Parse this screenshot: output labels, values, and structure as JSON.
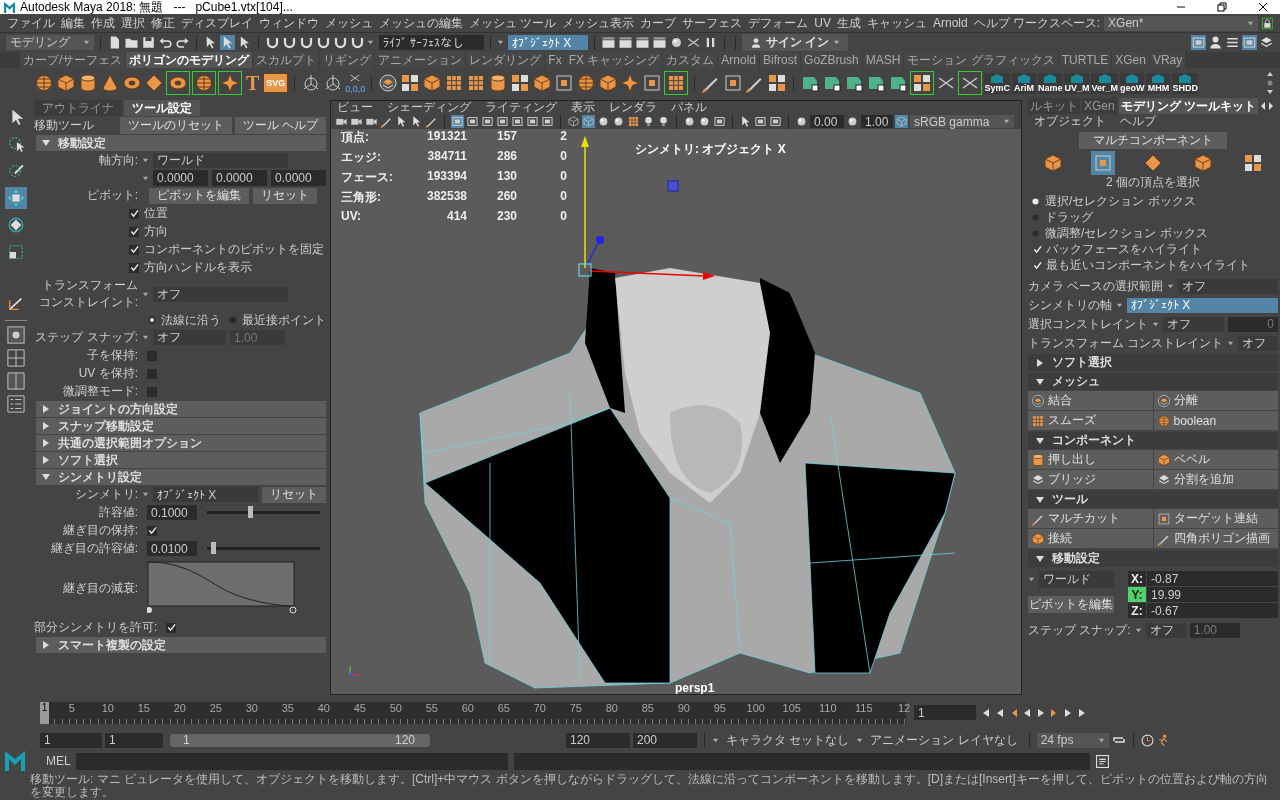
{
  "title_bar": {
    "title": "Autodesk Maya 2018: 無題   ---   pCube1.vtx[104]..."
  },
  "menu_bar": {
    "items": [
      "ファイル",
      "編集",
      "作成",
      "選択",
      "修正",
      "ディスプレイ",
      "ウィンドウ",
      "メッシュ",
      "メッシュの編集",
      "メッシュ ツール",
      "メッシュ表示",
      "カーブ",
      "サーフェス",
      "デフォーム",
      "UV",
      "生成",
      "キャッシュ",
      "Arnold",
      "ヘルプ"
    ],
    "workspace_label": "ワークスペース:",
    "workspace": "XGen*"
  },
  "status_line": {
    "mode": "モデリング",
    "live_surface": "ﾗｲﾌﾞ ｻｰﾌｪｽなし",
    "symmetry": "ｵﾌﾞｼﾞｪｸﾄ X",
    "sign_in": "サイン イン"
  },
  "shelf": {
    "tabs": [
      {
        "label": "カーブ/サーフェス",
        "selected": false
      },
      {
        "label": "ポリゴンのモデリング",
        "selected": true
      },
      {
        "label": "スカルプト",
        "selected": false
      },
      {
        "label": "リギング",
        "selected": false
      },
      {
        "label": "アニメーション",
        "selected": false
      },
      {
        "label": "レンダリング",
        "selected": false
      },
      {
        "label": "Fx",
        "selected": false
      },
      {
        "label": "FX キャッシング",
        "selected": false
      },
      {
        "label": "カスタム",
        "selected": false
      },
      {
        "label": "Arnold",
        "selected": false
      },
      {
        "label": "Bifrost",
        "selected": false
      },
      {
        "label": "GoZBrush",
        "selected": false
      },
      {
        "label": "MASH",
        "selected": false
      },
      {
        "label": "モーション グラフィックス",
        "selected": false
      },
      {
        "label": "TURTLE",
        "selected": false
      },
      {
        "label": "XGen",
        "selected": false
      },
      {
        "label": "VRay",
        "selected": false
      }
    ],
    "text_tools": [
      "T",
      "SVG"
    ],
    "coordinate_label": "0,0,0",
    "scripts": [
      "SymC",
      "AriM",
      "Name",
      "UV_M",
      "Ver_M",
      "geoW",
      "MHM",
      "SHDD"
    ]
  },
  "toolbox": {
    "tools": [
      {
        "selected": false
      },
      {
        "selected": false
      },
      {
        "selected": false
      },
      {
        "selected": true
      },
      {
        "selected": false
      },
      {
        "selected": false
      },
      {
        "selected": false
      }
    ]
  },
  "tool_settings": {
    "tabs": [
      {
        "label": "アウトライナ",
        "selected": false
      },
      {
        "label": "ツール設定",
        "selected": true
      }
    ],
    "tool_name": "移動ツール",
    "buttons": [
      "ツールのリセット",
      "ツール ヘルプ"
    ],
    "sections": [
      {
        "title": "移動設定",
        "expanded": true,
        "rows": [
          {
            "kind": "dropdown",
            "label": "軸方向:",
            "value": "ワールド"
          },
          {
            "kind": "fields",
            "values": [
              "0.0000",
              "0.0000",
              "0.0000"
            ]
          },
          {
            "kind": "buttons",
            "label": "ピボット:",
            "buttons": [
              "ピボットを編集",
              "リセット"
            ]
          },
          {
            "kind": "check",
            "text": "位置",
            "checked": true
          },
          {
            "kind": "check",
            "text": "方向",
            "checked": true
          },
          {
            "kind": "check",
            "text": "コンポーネントのピボットを固定",
            "checked": true
          },
          {
            "kind": "check",
            "text": "方向ハンドルを表示",
            "checked": true
          },
          {
            "kind": "dropdown",
            "label": "トランスフォームコンストレイント:",
            "value": "オフ"
          },
          {
            "kind": "radio",
            "options": [
              {
                "label": "法線に沿う",
                "selected": true
              },
              {
                "label": "最近接ポイント",
                "selected": false
              }
            ]
          },
          {
            "kind": "dropdown",
            "label": "ステップ スナップ:",
            "value": "オフ",
            "extra": "1.00"
          },
          {
            "kind": "boxcheck",
            "label": "子を保持:",
            "checked": false
          },
          {
            "kind": "boxcheck",
            "label": "UV を保持:",
            "checked": false
          },
          {
            "kind": "boxcheck",
            "label": "微調整モード:",
            "checked": false
          }
        ]
      },
      {
        "title": "ジョイントの方向設定",
        "expanded": false
      },
      {
        "title": "スナップ移動設定",
        "expanded": false
      },
      {
        "title": "共通の選択範囲オプション",
        "expanded": false
      },
      {
        "title": "ソフト選択",
        "expanded": false
      },
      {
        "title": "シンメトリ設定",
        "expanded": true,
        "rows": [
          {
            "kind": "dropdown",
            "label": "シンメトリ:",
            "value": "ｵﾌﾞｼﾞｪｸﾄ X",
            "button": "リセット"
          },
          {
            "kind": "slider",
            "label": "許容値:",
            "value": "0.1000",
            "level": 0.38
          },
          {
            "kind": "boxcheck",
            "label": "継ぎ目の保持:",
            "checked": true
          },
          {
            "kind": "slider",
            "label": "継ぎ目の許容値:",
            "value": "0.0100",
            "level": 0.05
          },
          {
            "kind": "curve",
            "label": "継ぎ目の減衰:"
          },
          {
            "kind": "boxcheck",
            "label": "部分シンメトリを許可:",
            "checked": true
          }
        ]
      },
      {
        "title": "スマート複製の設定",
        "expanded": false
      }
    ]
  },
  "viewport": {
    "menu": [
      "ビュー",
      "シェーディング",
      "ライティング",
      "表示",
      "レンダラ",
      "パネル"
    ],
    "exposure": "0.00",
    "gamma": "1.00",
    "color_space": "sRGB gamma",
    "hud": [
      {
        "label": "頂点:",
        "values": [
          "191321",
          "157",
          "2"
        ]
      },
      {
        "label": "エッジ:",
        "values": [
          "384711",
          "286",
          "0"
        ]
      },
      {
        "label": "フェース:",
        "values": [
          "193394",
          "130",
          "0"
        ]
      },
      {
        "label": "三角形:",
        "values": [
          "382538",
          "260",
          "0"
        ]
      },
      {
        "label": "UV:",
        "values": [
          "414",
          "230",
          "0"
        ]
      }
    ],
    "symmetry_label": "シンメトリ: オブジェクト X",
    "camera": "persp1"
  },
  "toolkit": {
    "tabs": [
      {
        "label": "ルキット",
        "selected": false
      },
      {
        "label": "XGen",
        "selected": false
      },
      {
        "label": "モデリング ツールキット",
        "selected": true
      }
    ],
    "menu": [
      "オブジェクト",
      "ヘルプ"
    ],
    "multi_component": "マルチコンポーネント",
    "modes": [
      {
        "selected": false
      },
      {
        "selected": true
      },
      {
        "selected": false
      },
      {
        "selected": false
      },
      {
        "selected": false
      }
    ],
    "selection_info": "2 個の頂点を選択",
    "pick_modes": [
      {
        "label": "選択/セレクション ボックス",
        "selected": true
      },
      {
        "label": "ドラッグ",
        "selected": false
      },
      {
        "label": "微調整/セレクション ボックス",
        "selected": false
      }
    ],
    "options": [
      {
        "label": "バックフェースをハイライト",
        "checked": true
      },
      {
        "label": "最も近いコンポーネントをハイライト",
        "checked": true
      }
    ],
    "settings": [
      {
        "label": "カメラ ベースの選択範囲",
        "value": "オフ",
        "highlighted": false
      },
      {
        "label": "シンメトリの軸",
        "value": "ｵﾌﾞｼﾞｪｸﾄ X",
        "highlighted": true
      },
      {
        "label": "選択コンストレイント",
        "value": "オフ",
        "extra": "0",
        "highlighted": false
      },
      {
        "label": "トランスフォーム コンストレイント",
        "value": "オフ",
        "highlighted": false
      }
    ],
    "sections": [
      {
        "title": "ソフト選択",
        "expanded": false
      },
      {
        "title": "メッシュ",
        "expanded": true,
        "buttons": [
          "結合",
          "分離",
          "スムーズ",
          "boolean"
        ]
      },
      {
        "title": "コンポーネント",
        "expanded": true,
        "buttons": [
          "押し出し",
          "ベベル",
          "ブリッジ",
          "分割を追加"
        ]
      },
      {
        "title": "ツール",
        "expanded": true,
        "buttons": [
          "マルチカット",
          "ターゲット連結",
          "接続",
          "四角ポリゴン描画"
        ]
      },
      {
        "title": "移動設定",
        "expanded": true
      }
    ],
    "move": {
      "space": "ワールド",
      "pivot_button": "ピボットを編集",
      "coords": [
        {
          "axis": "X:",
          "value": "-0.87",
          "active": false
        },
        {
          "axis": "Y:",
          "value": "19.99",
          "active": true
        },
        {
          "axis": "Z:",
          "value": "-0.67",
          "active": false
        }
      ],
      "step_label": "ステップ スナップ:",
      "step_value": "オフ",
      "step_extra": "1.00"
    }
  },
  "timeline": {
    "current": "1",
    "level": 0,
    "ticks": [
      "5",
      "10",
      "15",
      "20",
      "25",
      "30",
      "35",
      "40",
      "45",
      "50",
      "55",
      "60",
      "65",
      "70",
      "75",
      "80",
      "85",
      "90",
      "95",
      "100",
      "105",
      "110",
      "115",
      "12"
    ],
    "frame_field": "1"
  },
  "range": {
    "start": "1",
    "playback_start": "1",
    "slider_start": "1",
    "slider_end": "120",
    "playback_end": "120",
    "end": "200",
    "character_set": "キャラクタ セットなし",
    "anim_layer": "アニメーション レイヤなし",
    "fps": "24 fps"
  },
  "command_line": {
    "language": "MEL"
  },
  "help_line": "移動ツール: マニ ピュレータを使用して、オブジェクトを移動します。[Ctrl]+中マウス ボタンを押しながらドラッグして、法線に沿ってコンポーネントを移動します。[D]または[Insert]キーを押して、ピボットの位置および軸の方向を変更します。"
}
